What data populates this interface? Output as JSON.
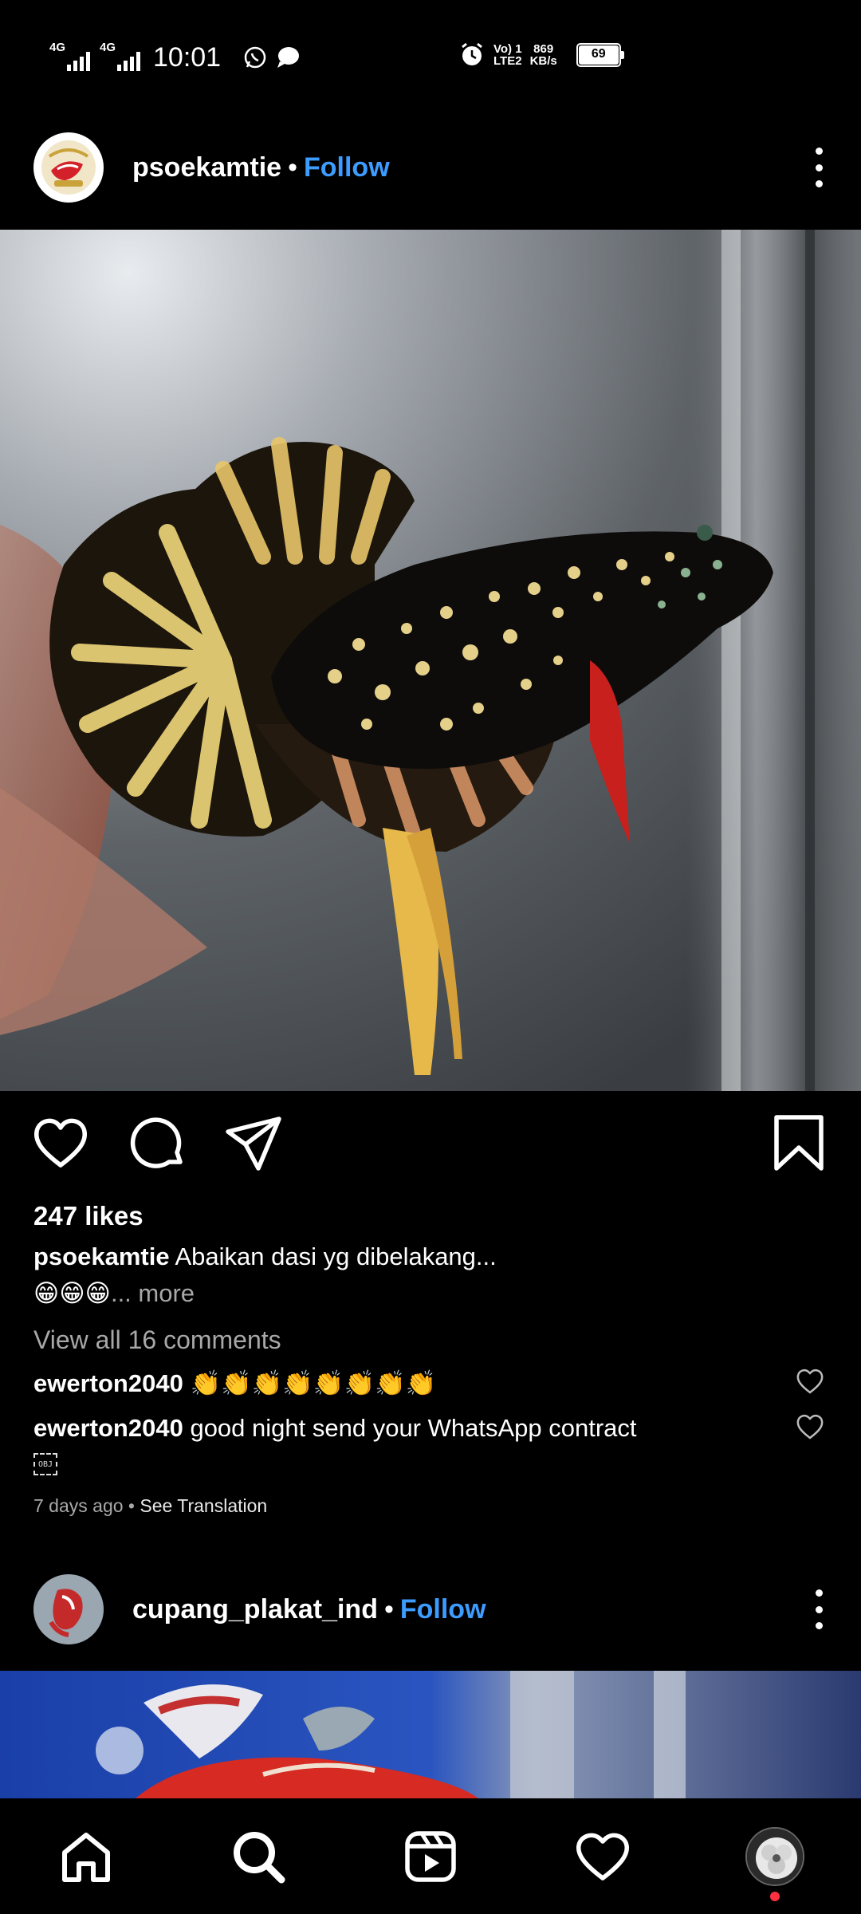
{
  "status_bar": {
    "network1": "4G",
    "network2": "4G",
    "time": "10:01",
    "volte": "Vo) 1",
    "lte": "LTE2",
    "speed_value": "869",
    "speed_unit": "KB/s",
    "battery": "69"
  },
  "post1": {
    "username": "psoekamtie",
    "dot": "•",
    "follow_label": "Follow",
    "likes": "247 likes",
    "caption_username": "psoekamtie",
    "caption_text": "Abaikan dasi yg dibelakang...",
    "caption_emojis": "😁😁😁",
    "more_label": "... more",
    "view_comments": "View all 16 comments",
    "comments": [
      {
        "username": "ewerton2040",
        "text": "👏👏👏👏👏👏👏👏"
      },
      {
        "username": "ewerton2040",
        "text": "good night send your WhatsApp contract"
      }
    ],
    "obj_marker": "OBJ",
    "timestamp": "7 days ago",
    "timestamp_sep": "•",
    "see_translation": "See Translation"
  },
  "post2": {
    "username": "cupang_plakat_ind",
    "dot": "•",
    "follow_label": "Follow"
  },
  "colors": {
    "background": "#000000",
    "follow_blue": "#3d9cff",
    "muted_text": "#a8a8a8",
    "notification_dot": "#ff3040"
  },
  "icons": {
    "actions": [
      "heart-icon",
      "comment-icon",
      "share-icon",
      "bookmark-icon"
    ],
    "nav": [
      "home-icon",
      "search-icon",
      "reels-icon",
      "activity-heart-icon",
      "profile-avatar"
    ]
  }
}
